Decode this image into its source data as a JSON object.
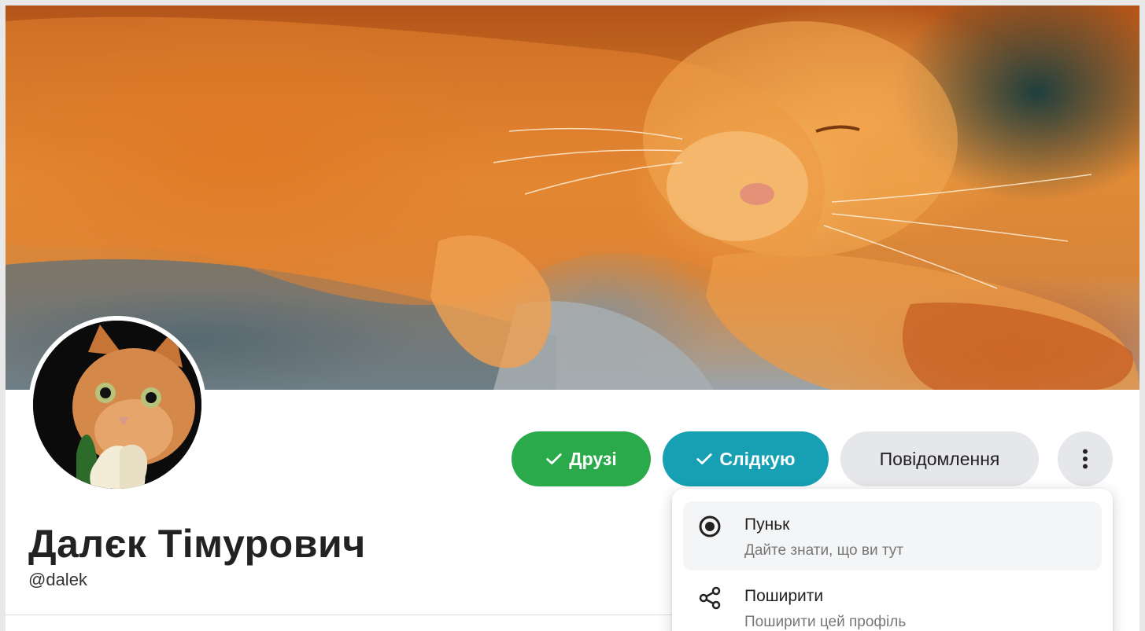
{
  "profile": {
    "name": "Далєк Тімурович",
    "handle": "@dalek"
  },
  "actions": {
    "friends_label": "Друзі",
    "following_label": "Слідкую",
    "message_label": "Повідомлення"
  },
  "menu": {
    "items": [
      {
        "title": "Пуньк",
        "subtitle": "Дайте знати, що ви тут",
        "icon": "target-icon"
      },
      {
        "title": "Поширити",
        "subtitle": "Поширити цей профіль",
        "icon": "share-icon"
      }
    ]
  },
  "colors": {
    "friends_green": "#2aaa4a",
    "following_teal": "#17a0b4",
    "neutral_button": "#e6e7eb"
  }
}
